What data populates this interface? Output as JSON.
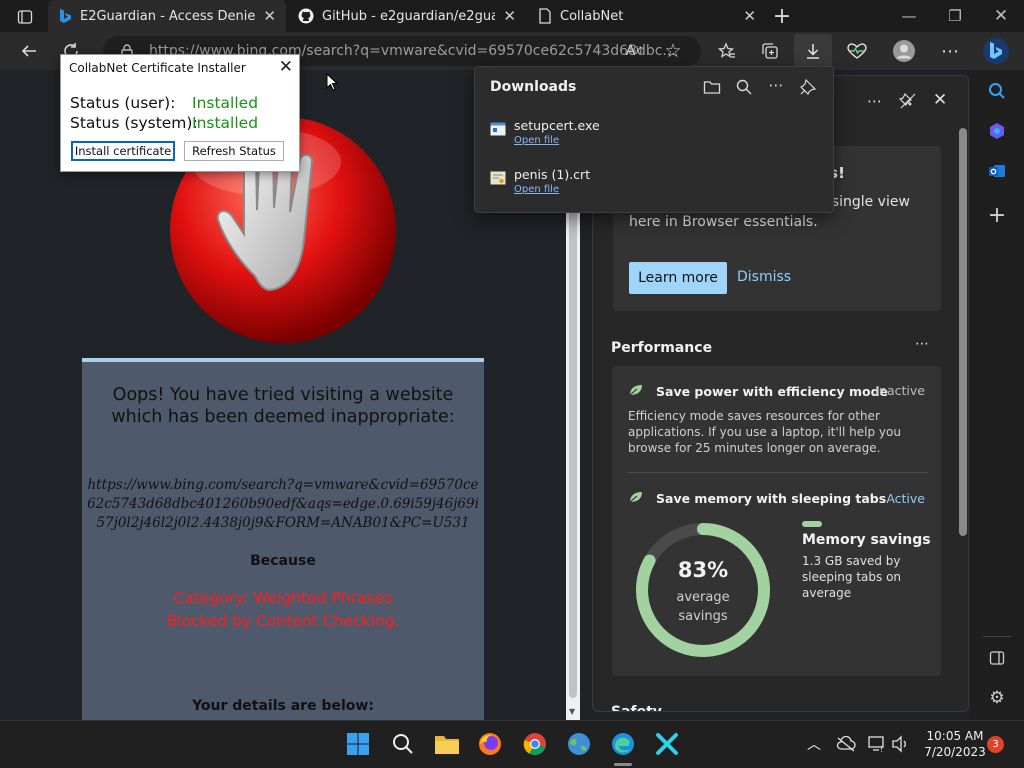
{
  "tabs": [
    {
      "label": "E2Guardian - Access Denied",
      "icon": "bing-icon",
      "active": true
    },
    {
      "label": "GitHub - e2guardian/e2guardian",
      "icon": "github-icon",
      "active": false
    },
    {
      "label": "CollabNet",
      "icon": "page-icon",
      "active": false
    }
  ],
  "address": {
    "url": "https://www.bing.com/search?q=vmware&cvid=69570ce62c5743d68dbc..."
  },
  "page": {
    "headline": "Oops! You have tried visiting a website which has been deemed inappropriate:",
    "blocked_url": "https://www.bing.com/search?q=vmware&cvid=69570ce62c5743d68dbc401260b90edf&aqs=edge.0.69i59j46j69i57j0l2j46l2j0l2.4438j0j9&FORM=ANAB01&PC=U531",
    "because": "Because",
    "reason_line1": "Category: Weighted Phrases",
    "reason_line2": "Blocked by Content Checking.",
    "details": "Your details are below:"
  },
  "installer": {
    "title": "CollabNet Certificate Installer",
    "status_user_label": "Status (user):",
    "status_user_value": "Installed",
    "status_system_label": "Status (system):",
    "status_system_value": "Installed",
    "install_button": "Install certificate",
    "refresh_button": "Refresh Status",
    "status_color": "#149314"
  },
  "downloads": {
    "title": "Downloads",
    "items": [
      {
        "name": "setupcert.exe",
        "action": "Open file"
      },
      {
        "name": "penis (1).crt",
        "action": "Open file"
      }
    ]
  },
  "essentials": {
    "promo_title": "als!",
    "promo_body": "performance and safety in a single view here in Browser essentials.",
    "learn_more": "Learn more",
    "dismiss": "Dismiss",
    "performance_title": "Performance",
    "efficiency": {
      "title": "Save power with efficiency mode",
      "status": "Inactive",
      "description": "Efficiency mode saves resources for other applications. If you use a laptop, it'll help you browse for 25 minutes longer on average."
    },
    "sleeping_tabs": {
      "title": "Save memory with sleeping tabs",
      "status": "Active"
    },
    "memory": {
      "percent_label": "83%",
      "percent_value": 83,
      "avg_line1": "average",
      "avg_line2": "savings",
      "title": "Memory savings",
      "description": "1.3 GB saved by sleeping tabs on average"
    },
    "next_section_fragment": "Safety"
  },
  "taskbar": {
    "time": "10:05 AM",
    "date": "7/20/2023",
    "notifications": "3"
  },
  "colors": {
    "accent": "#9fd5f8",
    "ring": "#a3d2a1",
    "blocked_red": "#ff1b1b"
  }
}
